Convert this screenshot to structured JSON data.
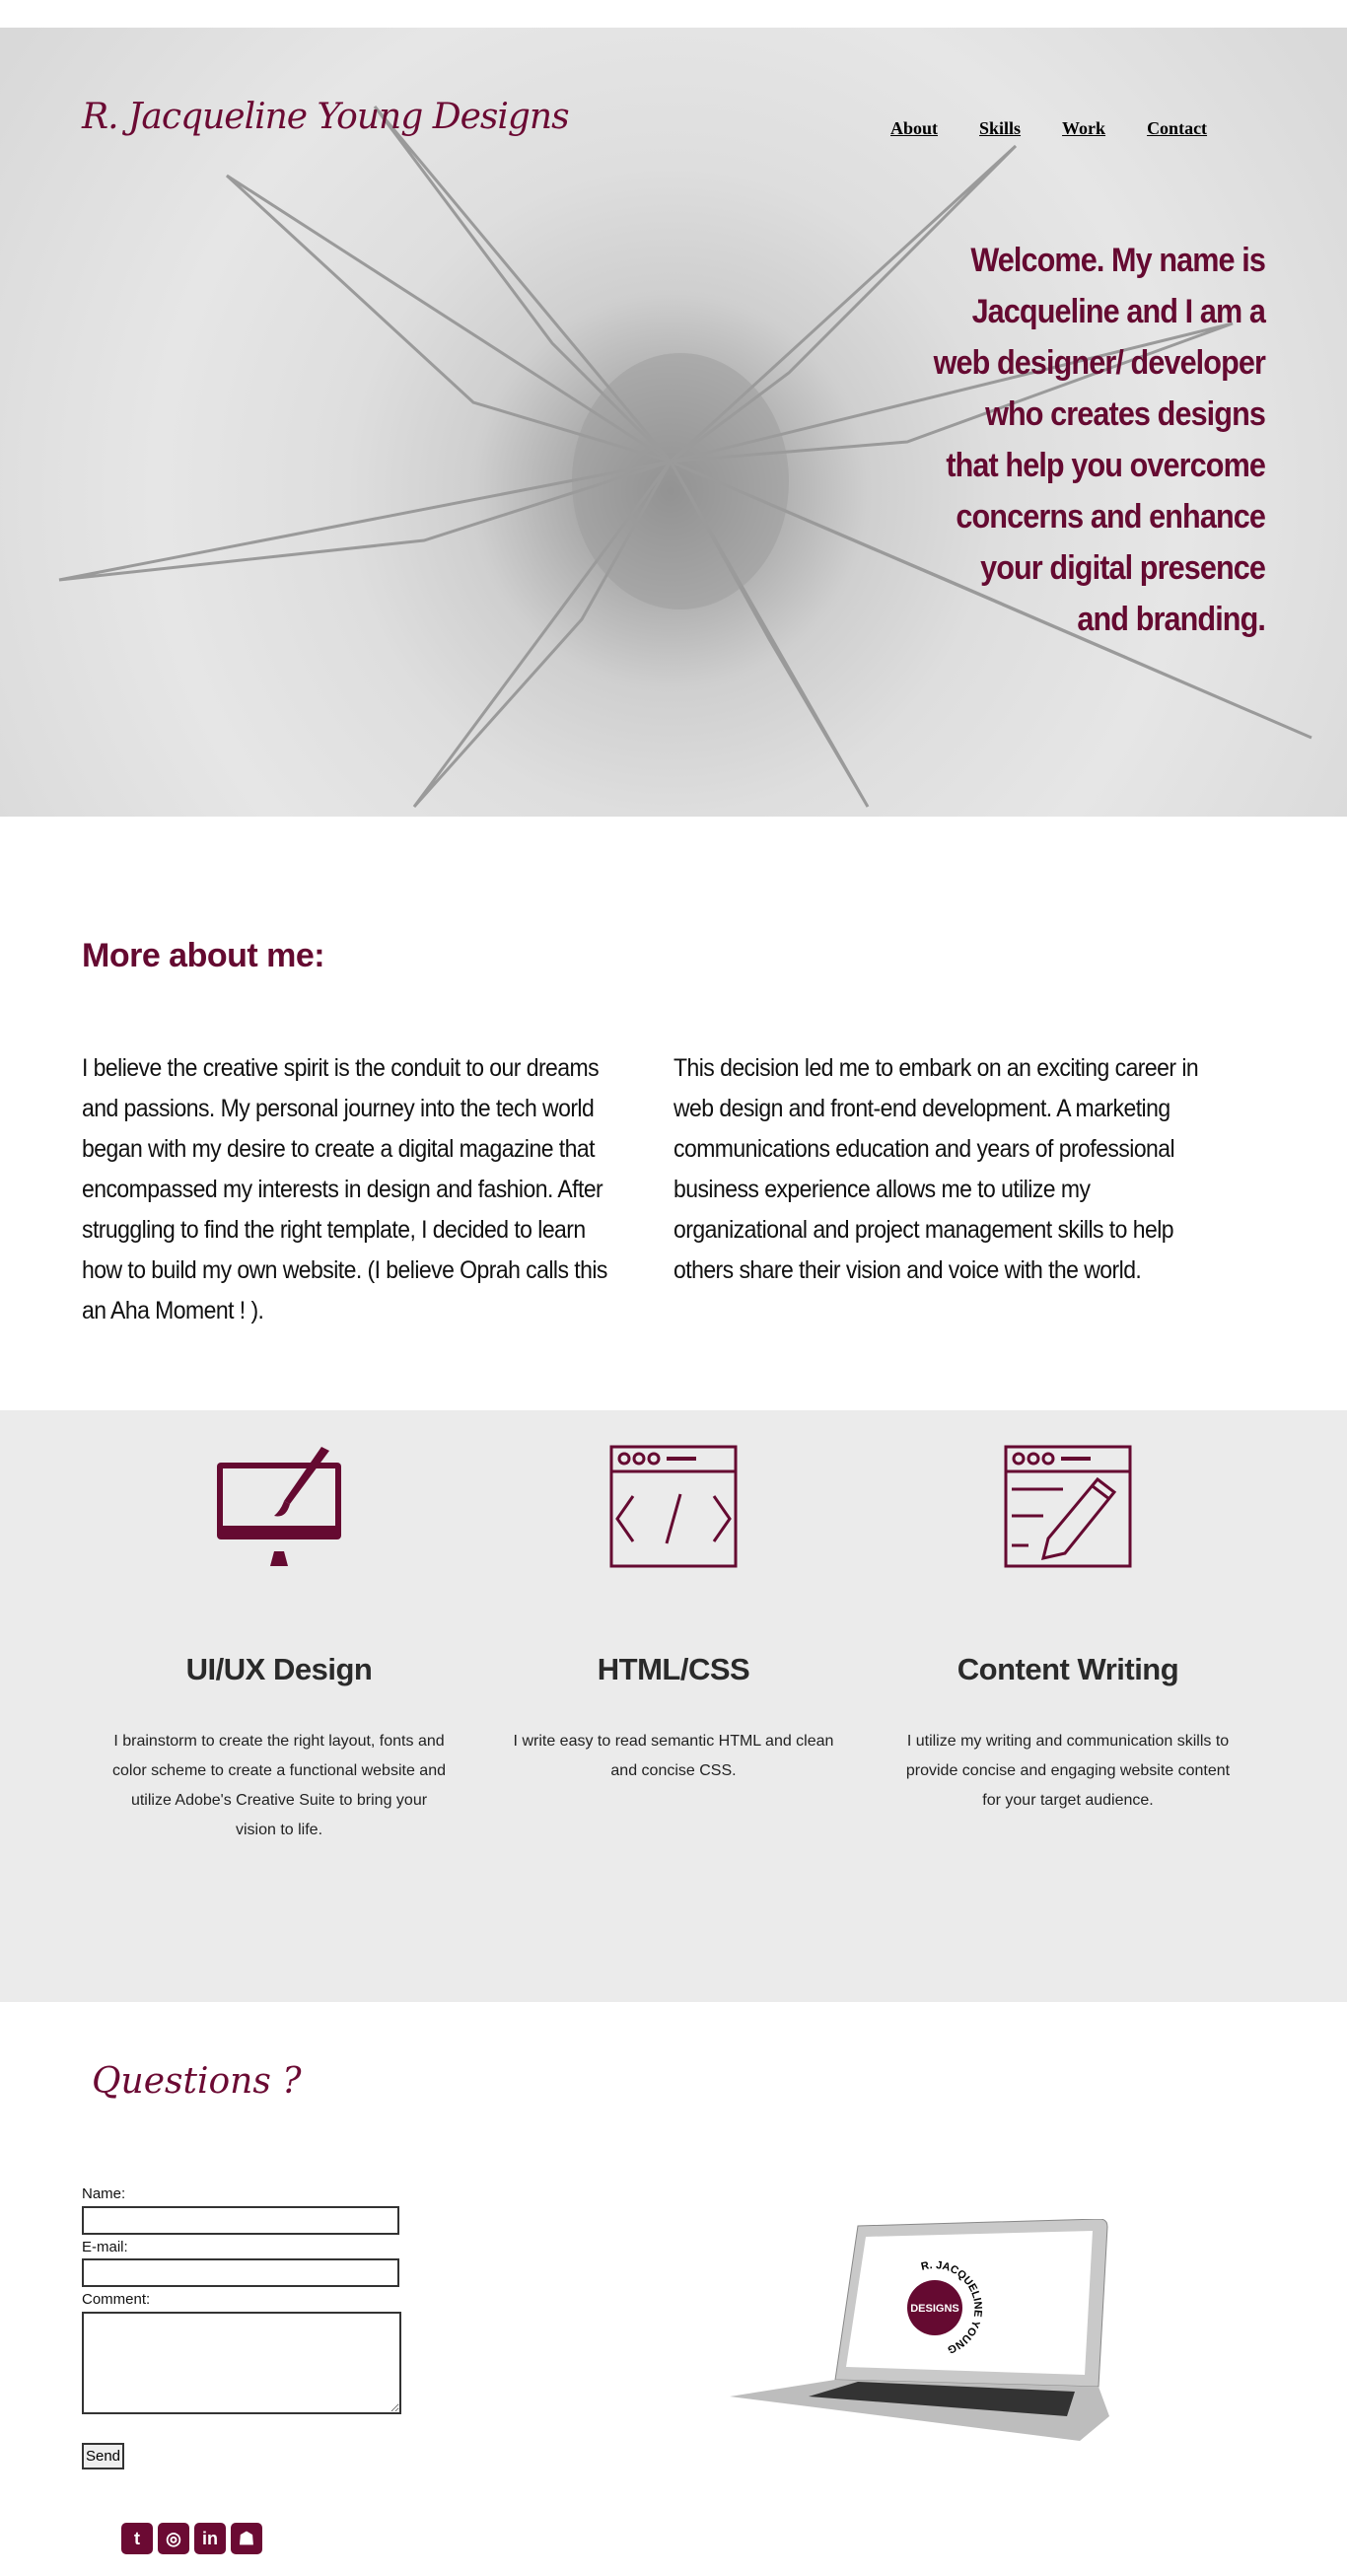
{
  "header": {
    "logo": "R. Jacqueline Young Designs",
    "nav": [
      "About",
      "Skills",
      "Work",
      "Contact"
    ],
    "welcome": "Welcome. My name is Jacqueline and I am a web designer/ developer who creates designs that help you overcome concerns and enhance your digital presence and branding."
  },
  "about": {
    "title": "More about me:",
    "col1": "I believe the creative spirit is the conduit to our dreams and passions. My personal journey into the tech world began with my desire to create a digital magazine that encompassed my interests in design and fashion. After struggling to find the right template, I decided to learn how to build my own website. (I believe Oprah calls this an Aha Moment ! ).",
    "col2": "This decision led me to embark on an exciting career in web design and front-end development. A marketing communications education and years of professional business experience allows me to utilize my organizational and project management skills to help others share their vision and voice with the world."
  },
  "skills": [
    {
      "icon": "monitor-paintbrush-icon",
      "title": "UI/UX Design",
      "text": "I brainstorm to create the right layout, fonts and color scheme to create a functional website and utilize Adobe's Creative Suite to bring your vision to life."
    },
    {
      "icon": "code-window-icon",
      "title": "HTML/CSS",
      "text": "I write easy to read semantic HTML and clean and concise CSS."
    },
    {
      "icon": "pencil-window-icon",
      "title": "Content Writing",
      "text": "I utilize my writing and communication skills to provide concise and engaging website content for your target audience."
    }
  ],
  "contact": {
    "title": "Questions ?",
    "name_label": "Name:",
    "email_label": "E-mail:",
    "comment_label": "Comment:",
    "send": "Send",
    "laptop_logo": {
      "ring": "R. JACQUELINE YOUNG",
      "center": "DESIGNS"
    }
  },
  "social": [
    "twitter-icon",
    "instagram-icon",
    "linkedin-icon",
    "github-icon"
  ],
  "colors": {
    "accent": "#650a31",
    "gray_bg": "#ebebeb"
  }
}
